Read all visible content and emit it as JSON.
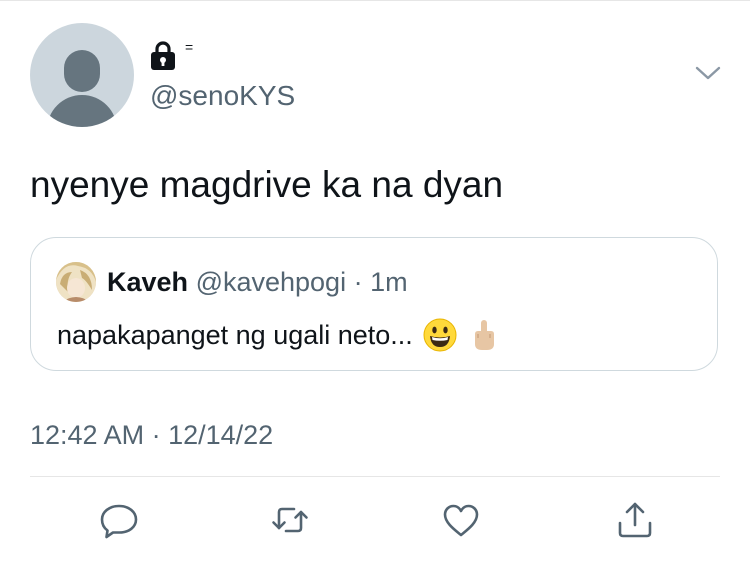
{
  "tweet": {
    "display_name": "=",
    "handle": "@senoKYS",
    "text": "nyenye magdrive ka na dyan",
    "timestamp": "12:42 AM · 12/14/22",
    "icons": {
      "lock": "lock-icon",
      "menu": "chevron-down-icon"
    }
  },
  "quote": {
    "name": "Kaveh",
    "handle": "@kavehpogi",
    "separator": "·",
    "time": "1m",
    "text": "napakapanget ng ugali neto...",
    "emojis": [
      "grinning-face-emoji",
      "middle-finger-emoji"
    ]
  },
  "actions": [
    {
      "name": "reply-icon"
    },
    {
      "name": "retweet-icon"
    },
    {
      "name": "like-icon"
    },
    {
      "name": "share-icon"
    }
  ],
  "colors": {
    "text": "#0f1419",
    "secondary": "#536471",
    "border": "#cfd9de",
    "avatar_bg": "#ccd6dd",
    "avatar_fg": "#66757f"
  }
}
